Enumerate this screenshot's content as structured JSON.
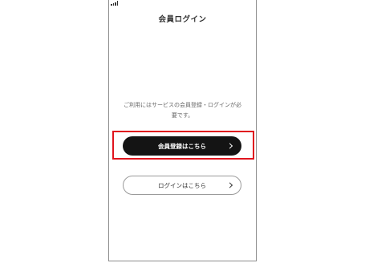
{
  "header": {
    "title": "会員ログイン"
  },
  "notice": {
    "line1": "ご利用にはサービスの会員登録・ログインが必",
    "line2": "要です。"
  },
  "buttons": {
    "register_label": "会員登録はこちら",
    "login_label": "ログインはこちら"
  },
  "colors": {
    "highlight": "#e0141e",
    "primary_button": "#141414",
    "text": "#333333"
  },
  "icons": {
    "status": "signal-strength-icon",
    "button_arrow": "chevron-right-icon"
  }
}
